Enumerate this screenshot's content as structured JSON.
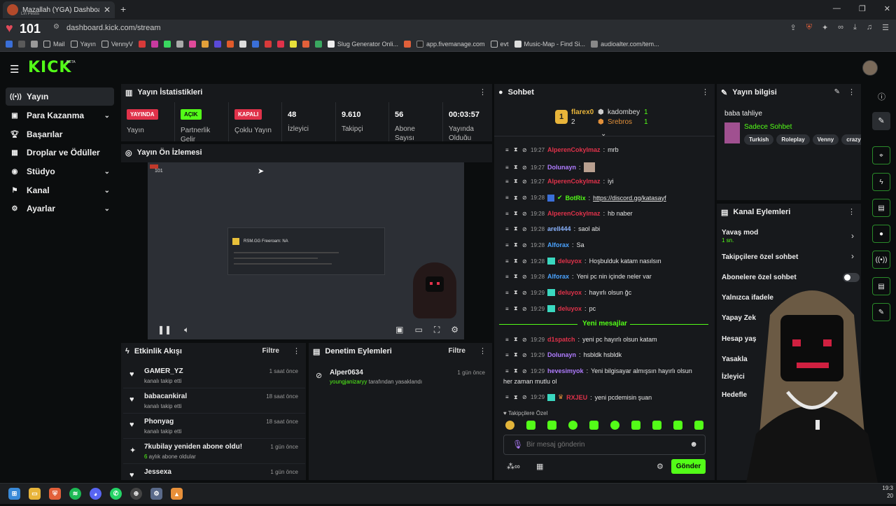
{
  "browser": {
    "tab_title": "Mazallah (YGA) Dashboard",
    "tab_subtitle": "Lin Pestis",
    "heart_count": "101",
    "url": "dashboard.kick.com/stream"
  },
  "bookmarks": [
    "Mail",
    "Yayın",
    "VennyV",
    "Slug Generator Onli...",
    "app.fivemanage.com",
    "evt",
    "Music-Map - Find Si...",
    "audioalter.com/tem..."
  ],
  "header": {
    "logo": "KICK",
    "beta": "BETA"
  },
  "sidebar": {
    "items": [
      {
        "label": "Yayın",
        "icon": "broadcast-icon",
        "chevron": false,
        "active": true
      },
      {
        "label": "Para Kazanma",
        "icon": "money-icon",
        "chevron": true
      },
      {
        "label": "Başarılar",
        "icon": "trophy-icon",
        "chevron": false
      },
      {
        "label": "Droplar ve Ödüller",
        "icon": "gift-icon",
        "chevron": false
      },
      {
        "label": "Stüdyo",
        "icon": "studio-icon",
        "chevron": true
      },
      {
        "label": "Kanal",
        "icon": "flag-icon",
        "chevron": true
      },
      {
        "label": "Ayarlar",
        "icon": "gear-icon",
        "chevron": true
      }
    ]
  },
  "stats": {
    "title": "Yayın İstatistikleri",
    "badges": [
      {
        "text": "YAYINDA",
        "label": "Yayın",
        "bg": "#e0324a",
        "fg": "#ffffff"
      },
      {
        "text": "AÇIK",
        "label": "Partnerlik Gelir",
        "bg": "#53fc18",
        "fg": "#0b0d0e"
      },
      {
        "text": "KAPALI",
        "label": "Çoklu Yayın",
        "bg": "#e0324a",
        "fg": "#ffffff"
      }
    ],
    "numbers": [
      {
        "value": "48",
        "label": "İzleyici"
      },
      {
        "value": "9.610",
        "label": "Takipçi"
      },
      {
        "value": "56",
        "label": "Abone Sayısı"
      },
      {
        "value": "00:03:57",
        "label": "Yayında Olduğu"
      }
    ]
  },
  "preview": {
    "title": "Yayın Ön İzlemesi",
    "mini_count": "101",
    "inner_title": "RSM.GG Freeroam: NA"
  },
  "activity": {
    "title": "Etkinlik Akışı",
    "filter": "Filtre",
    "items": [
      {
        "name": "GAMER_YZ",
        "sub": "kanalı takip etti",
        "time": "1 saat önce",
        "icon": "heart-icon"
      },
      {
        "name": "babacankiral",
        "sub": "kanalı takip etti",
        "time": "18 saat önce",
        "icon": "heart-icon"
      },
      {
        "name": "Phonyag",
        "sub": "kanalı takip etti",
        "time": "18 saat önce",
        "icon": "heart-icon"
      },
      {
        "name": "7kubilay yeniden abone oldu!",
        "sub_num": "6",
        "sub": " aylık abone oldular",
        "time": "1 gün önce",
        "icon": "star-icon"
      },
      {
        "name": "Jessexa",
        "sub": "",
        "time": "1 gün önce",
        "icon": "heart-icon"
      }
    ]
  },
  "moderation": {
    "title": "Denetim Eylemleri",
    "filter": "Filtre",
    "items": [
      {
        "name": "Alper0634",
        "by": "youngjanizaryy",
        "sub": " tarafından yasaklandı",
        "time": "1 gün önce"
      }
    ]
  },
  "chat": {
    "title": "Sohbet",
    "leaders": [
      {
        "rank": "1",
        "name": "flarex0",
        "count": "2"
      },
      {
        "name": "kadombey",
        "count": "1"
      },
      {
        "name": "Srebros",
        "count": "1"
      }
    ],
    "messages": [
      {
        "time": "19:27",
        "user": "AlperenCokylmaz",
        "color": "#e0324a",
        "text": "mrb"
      },
      {
        "time": "19:27",
        "user": "Dolunayn",
        "color": "#b07cff",
        "text": "",
        "emote": true
      },
      {
        "time": "19:27",
        "user": "AlperenCokylmaz",
        "color": "#e0324a",
        "text": "iyi"
      },
      {
        "time": "19:28",
        "user": "BotRix",
        "color": "#53fc18",
        "text": "",
        "link": "https://discord.gg/katasayf"
      },
      {
        "time": "19:28",
        "user": "AlperenCokylmaz",
        "color": "#e0324a",
        "text": "hb naber"
      },
      {
        "time": "19:28",
        "user": "arell444",
        "color": "#8ab4ff",
        "text": "saol abi"
      },
      {
        "time": "19:28",
        "user": "Alforax",
        "color": "#4aa3ff",
        "text": "Sa"
      },
      {
        "time": "19:28",
        "user": "deluyox",
        "color": "#e0324a",
        "text": "Hoşbulduk katam nasılsın"
      },
      {
        "time": "19:28",
        "user": "Alforax",
        "color": "#4aa3ff",
        "text": "Yeni pc nin içinde neler var"
      },
      {
        "time": "19:29",
        "user": "deluyox",
        "color": "#e0324a",
        "text": "hayırlı olsun ğc"
      },
      {
        "time": "19:29",
        "user": "deluyox",
        "color": "#e0324a",
        "text": "pc"
      }
    ],
    "divider": "Yeni mesajlar",
    "new_messages": [
      {
        "time": "19:29",
        "user": "d1spatch",
        "color": "#e0324a",
        "text": "yeni pc hayırlı olsun katam"
      },
      {
        "time": "19:29",
        "user": "Dolunayn",
        "color": "#b07cff",
        "text": "hsbldk hsbldk"
      },
      {
        "time": "19:29",
        "user": "hevesimyok",
        "color": "#b07cff",
        "text": "Yeni bilgisayar almışsın hayırlı olsun",
        "cont": "her zaman mutlu ol"
      },
      {
        "time": "19:29",
        "user": "RXJEU",
        "color": "#e0324a",
        "text": "yeni pcdemisin şuan"
      }
    ],
    "followers_only": "Takipçilere Özel",
    "input_placeholder": "Bir mesaj gönderin",
    "send": "Gönder"
  },
  "info": {
    "title": "Yayın bilgisi",
    "stream_title": "baba tahliye",
    "category": "Sadece Sohbet",
    "tags": [
      "Turkish",
      "Roleplay",
      "Venny",
      "crazy"
    ]
  },
  "channel_actions": {
    "title": "Kanal Eylemleri",
    "rows": [
      {
        "label": "Yavaş mod",
        "sub": "1 sn."
      },
      {
        "label": "Takipçilere özel sohbet"
      },
      {
        "label": "Abonelere özel sohbet"
      },
      {
        "label": "Yalnızca ifadele"
      },
      {
        "label": "Yapay Zek"
      },
      {
        "label": "Hesap yaş"
      },
      {
        "label": "Yasakla"
      },
      {
        "label": "İzleyici"
      },
      {
        "label": "Hedefle"
      }
    ]
  },
  "clock": {
    "time": "19:3",
    "date": "20"
  }
}
